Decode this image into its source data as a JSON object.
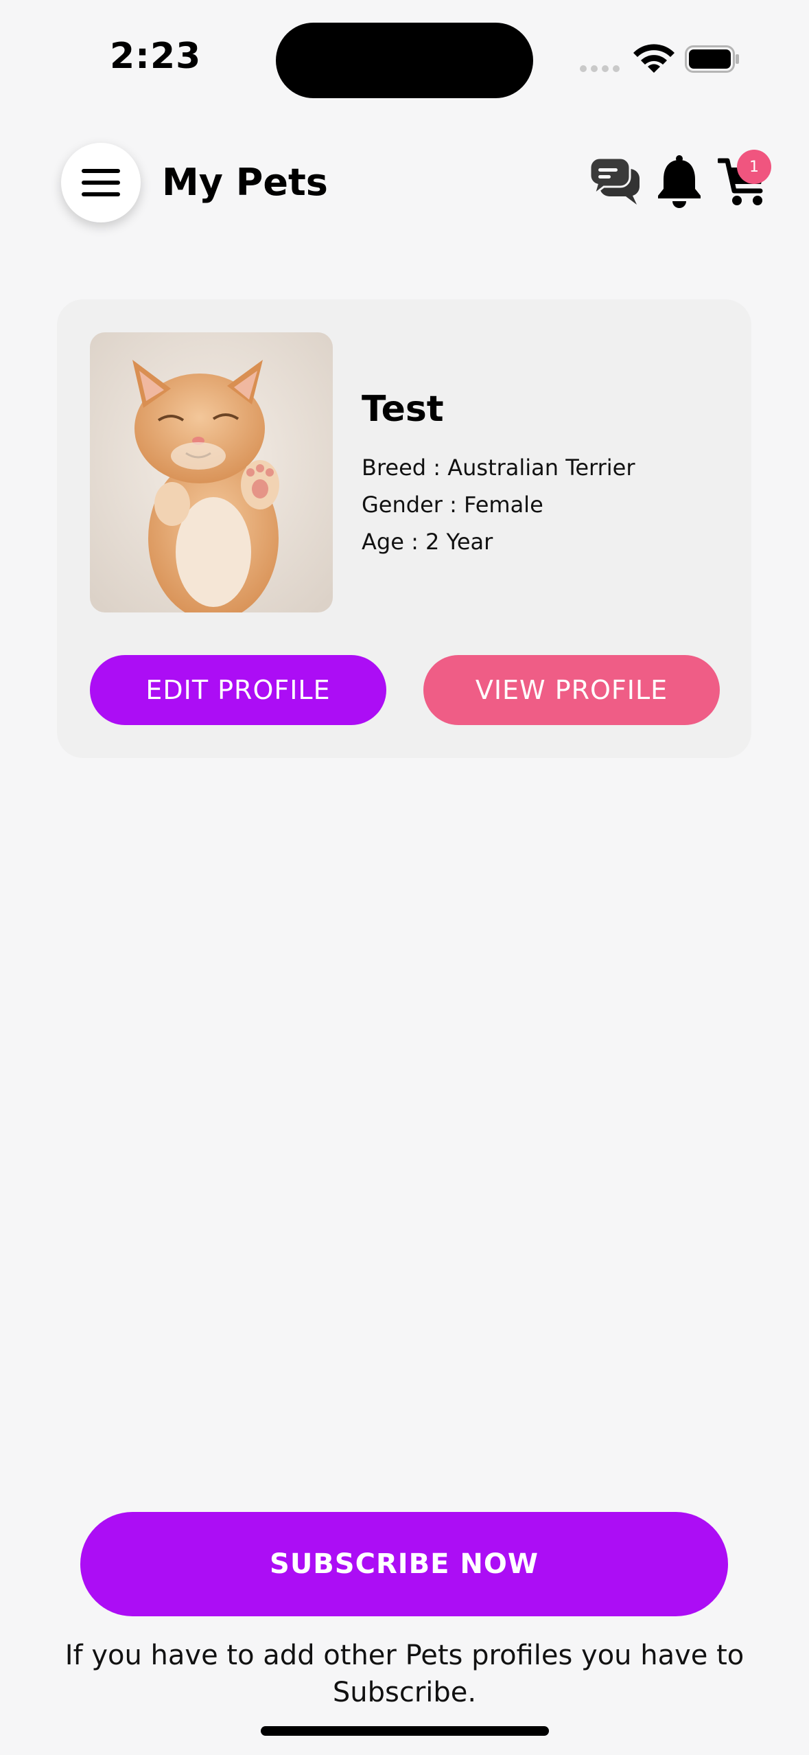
{
  "status_bar": {
    "time": "2:23"
  },
  "header": {
    "title": "My Pets",
    "cart_count": "1"
  },
  "pet": {
    "name": "Test",
    "breed": "Breed : Australian Terrier",
    "gender": "Gender : Female",
    "age": "Age : 2 Year",
    "edit_label": "EDIT PROFILE",
    "view_label": "VIEW PROFILE"
  },
  "subscribe": {
    "button_label": "SUBSCRIBE NOW",
    "note": "If you have to add other Pets profiles you have to Subscribe."
  },
  "colors": {
    "primary": "#ac0df5",
    "accent": "#ef5d86",
    "badge": "#f0557f"
  }
}
